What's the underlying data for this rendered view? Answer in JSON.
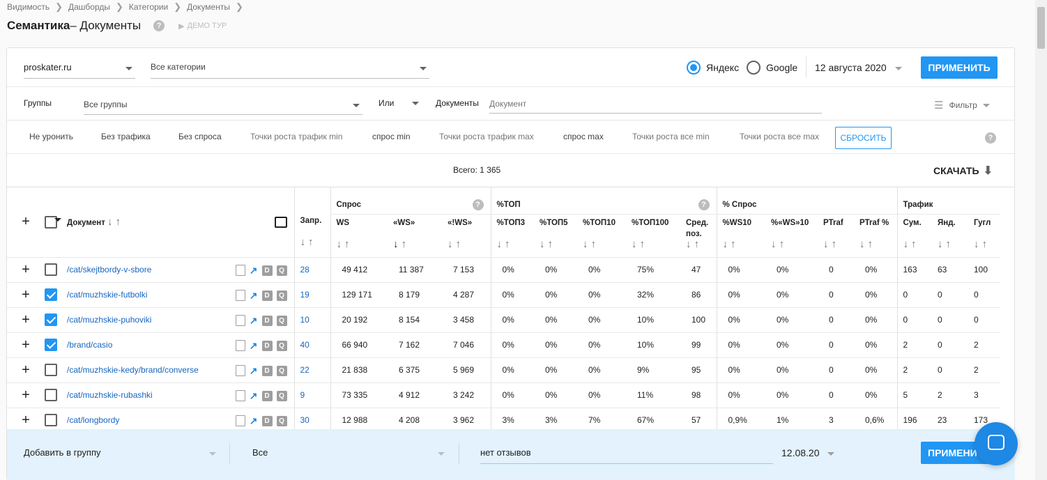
{
  "breadcrumbs": [
    "Видимость",
    "Дашборды",
    "Категории",
    "Документы"
  ],
  "page_title_bold": "Семантика",
  "page_title_rest": " – Документы",
  "help_mark": "?",
  "demo_tour": "ДЕМО ТУР",
  "filters": {
    "site": "proskater.ru",
    "category": "Все категории",
    "engine_yandex": "Яндекс",
    "engine_google": "Google",
    "date": "12 августа 2020",
    "apply": "ПРИМЕНИТЬ",
    "groups_label": "Группы",
    "groups_value": "Все группы",
    "logic": "Или",
    "documents_label": "Документы",
    "documents_placeholder": "Документ",
    "filter_label": "Фильтр"
  },
  "quick_filters": [
    "Не уронить",
    "Без трафика",
    "Без спроса",
    "Точки роста трафик min",
    "спрос min",
    "Точки роста трафик max",
    "спрос max",
    "Точки роста все min",
    "Точки роста все max"
  ],
  "reset": "СБРОСИТЬ",
  "total": "Всего: 1 365",
  "download": "СКАЧАТЬ",
  "table": {
    "doc_header": "Документ",
    "groups": {
      "spros": "Спрос",
      "top": "%ТОП",
      "pspros": "% Спрос",
      "traffic": "Трафик"
    },
    "columns": [
      "Запр.",
      "WS",
      "«WS»",
      "«!WS»",
      "%ТОП3",
      "%ТОП5",
      "%ТОП10",
      "%ТОП100",
      "Сред. поз.",
      "%WS10",
      "%«WS»10",
      "PTraf",
      "PTraf %",
      "Сум.",
      "Янд.",
      "Гугл"
    ],
    "rows": [
      {
        "url": "/cat/skejtbordy-v-sbore",
        "checked": false,
        "v": [
          "28",
          "49 412",
          "11 387",
          "7 153",
          "0%",
          "0%",
          "0%",
          "75%",
          "47",
          "0%",
          "0%",
          "0",
          "0%",
          "163",
          "63",
          "100"
        ]
      },
      {
        "url": "/cat/muzhskie-futbolki",
        "checked": true,
        "v": [
          "19",
          "129 171",
          "8 179",
          "4 287",
          "0%",
          "0%",
          "0%",
          "32%",
          "86",
          "0%",
          "0%",
          "0",
          "0%",
          "0",
          "0",
          "0"
        ]
      },
      {
        "url": "/cat/muzhskie-puhoviki",
        "checked": true,
        "v": [
          "10",
          "20 192",
          "8 154",
          "3 458",
          "0%",
          "0%",
          "0%",
          "10%",
          "100",
          "0%",
          "0%",
          "0",
          "0%",
          "0",
          "0",
          "0"
        ]
      },
      {
        "url": "/brand/casio",
        "checked": true,
        "v": [
          "40",
          "66 940",
          "7 162",
          "7 046",
          "0%",
          "0%",
          "0%",
          "10%",
          "99",
          "0%",
          "0%",
          "0",
          "0%",
          "2",
          "0",
          "2"
        ]
      },
      {
        "url": "/cat/muzhskie-kedy/brand/converse",
        "checked": false,
        "v": [
          "22",
          "21 838",
          "6 375",
          "5 969",
          "0%",
          "0%",
          "0%",
          "9%",
          "95",
          "0%",
          "0%",
          "0",
          "0%",
          "2",
          "0",
          "2"
        ]
      },
      {
        "url": "/cat/muzhskie-rubashki",
        "checked": false,
        "v": [
          "9",
          "73 335",
          "4 912",
          "3 242",
          "0%",
          "0%",
          "0%",
          "11%",
          "98",
          "0%",
          "0%",
          "0",
          "0%",
          "5",
          "2",
          "3"
        ]
      },
      {
        "url": "/cat/longbordy",
        "checked": false,
        "v": [
          "30",
          "12 988",
          "4 208",
          "3 962",
          "3%",
          "3%",
          "7%",
          "67%",
          "57",
          "0,9%",
          "1%",
          "3",
          "0,6%",
          "196",
          "23",
          "173"
        ]
      }
    ]
  },
  "bottom": {
    "add_to_group": "Добавить в группу",
    "all": "Все",
    "review": "нет отзывов",
    "date": "12.08.20",
    "apply": "ПРИМЕНИТЬ"
  }
}
